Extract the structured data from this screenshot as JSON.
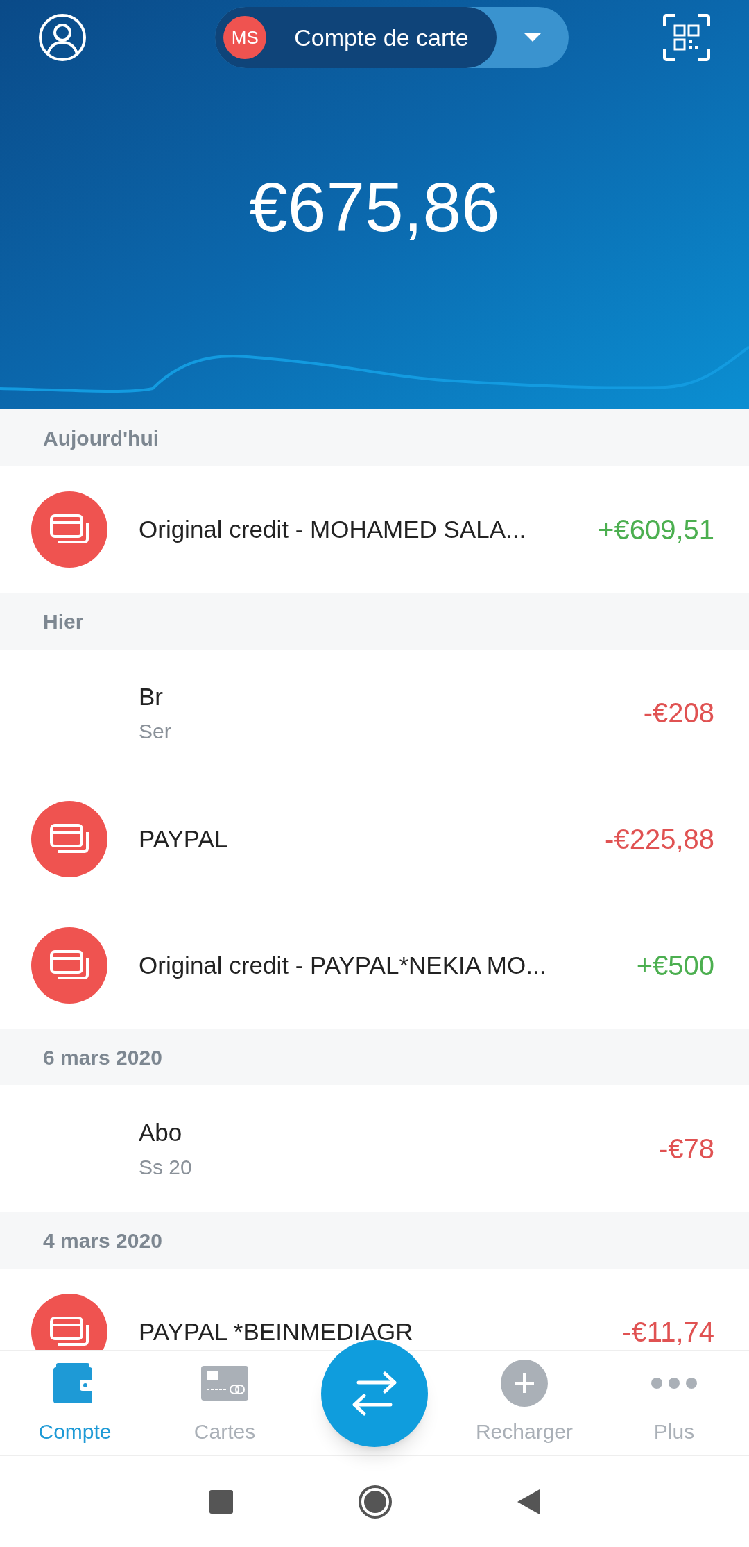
{
  "header": {
    "avatar_initials": "MS",
    "account": "Compte de carte",
    "balance": "€675,86"
  },
  "sections": [
    {
      "title": "Aujourd'hui",
      "rows": [
        {
          "kind": "card",
          "title": "Original credit - MOHAMED SALA...",
          "amount": "+€609,51",
          "credit": true
        }
      ]
    },
    {
      "title": "Hier",
      "rows": [
        {
          "kind": "hidden",
          "title": "Br",
          "subtitle": "Ser",
          "amount": "-€208",
          "credit": false
        },
        {
          "kind": "card",
          "title": "PAYPAL",
          "amount": "-€225,88",
          "credit": false
        },
        {
          "kind": "card",
          "title": "Original credit - PAYPAL*NEKIA  MO...",
          "amount": "+€500",
          "credit": true
        }
      ]
    },
    {
      "title": "6 mars 2020",
      "rows": [
        {
          "kind": "hidden",
          "title": "Abo",
          "subtitle": "Ss 20",
          "amount": "-€78",
          "credit": false
        }
      ]
    },
    {
      "title": "4 mars 2020",
      "rows": [
        {
          "kind": "card",
          "title": "PAYPAL *BEINMEDIAGR",
          "amount": "-€11,74",
          "credit": false
        }
      ]
    }
  ],
  "nav": [
    {
      "kind": "wallet",
      "label": "Compte",
      "selected": true
    },
    {
      "kind": "cards",
      "label": "Cartes",
      "selected": false
    },
    {
      "kind": "transfer"
    },
    {
      "kind": "plus",
      "label": "Recharger",
      "selected": false
    },
    {
      "kind": "more",
      "label": "Plus",
      "selected": false
    }
  ]
}
